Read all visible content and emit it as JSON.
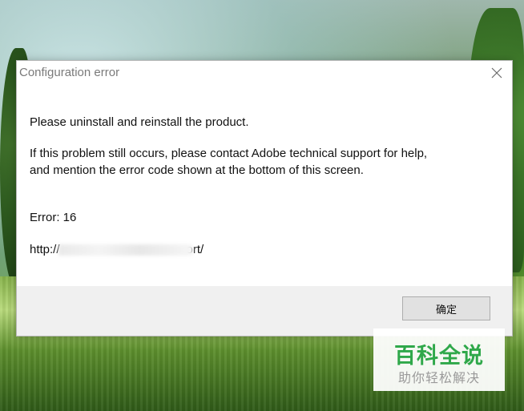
{
  "dialog": {
    "title": "Configuration error",
    "messages": {
      "line1": "Please uninstall and reinstall the product.",
      "line2": "If this problem still occurs, please contact Adobe technical support for help,",
      "line3": "and mention the error code shown at the bottom of this screen.",
      "error": "Error: 16",
      "url_prefix": "http://",
      "url_suffix": "ort/"
    },
    "buttons": {
      "ok_label": "确定"
    },
    "icons": {
      "close": "close-icon"
    }
  },
  "watermark": {
    "main": "百科全说",
    "sub": "助你轻松解决"
  },
  "colors": {
    "dialog_bg": "#ffffff",
    "footer_bg": "#f0f0f0",
    "button_bg": "#e1e1e1",
    "watermark_green": "#2fa84a"
  }
}
